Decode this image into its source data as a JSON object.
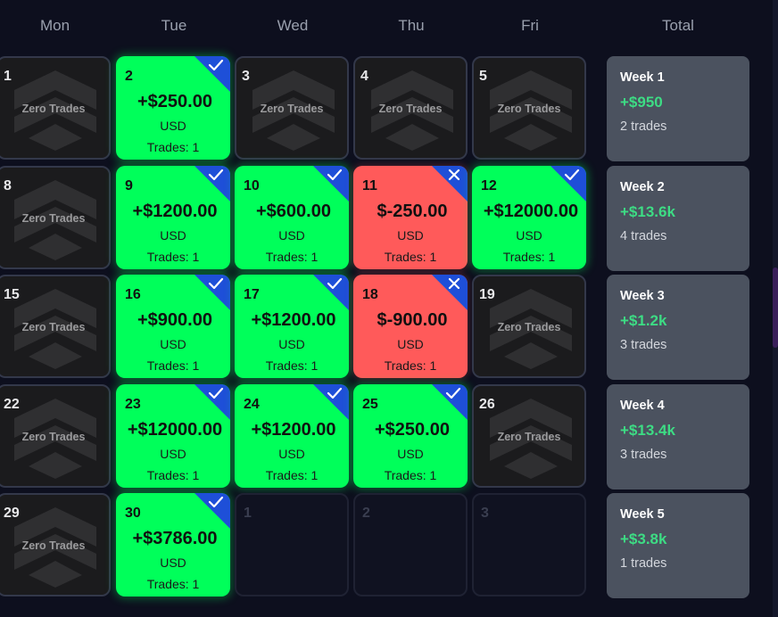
{
  "headers": [
    "Mon",
    "Tue",
    "Wed",
    "Thu",
    "Fri",
    "Total"
  ],
  "zero_label": "Zero Trades",
  "currency": "USD",
  "icons": {
    "zero": "chevrons-up-logo-icon",
    "win": "checkmark-icon",
    "loss": "x-icon"
  },
  "colors": {
    "win": "#00ff5a",
    "loss": "#ff5a5a",
    "corner": "#1e4fd8",
    "week_bg": "#4b525f",
    "week_total": "#3ddc84"
  },
  "rows": [
    [
      {
        "day": "1",
        "type": "zero"
      },
      {
        "day": "2",
        "type": "win",
        "amount": "+$250.00",
        "trades": "Trades: 1"
      },
      {
        "day": "3",
        "type": "zero"
      },
      {
        "day": "4",
        "type": "zero"
      },
      {
        "day": "5",
        "type": "zero"
      }
    ],
    [
      {
        "day": "8",
        "type": "zero"
      },
      {
        "day": "9",
        "type": "win",
        "amount": "+$1200.00",
        "trades": "Trades: 1"
      },
      {
        "day": "10",
        "type": "win",
        "amount": "+$600.00",
        "trades": "Trades: 1"
      },
      {
        "day": "11",
        "type": "loss",
        "amount": "$-250.00",
        "trades": "Trades: 1"
      },
      {
        "day": "12",
        "type": "win",
        "amount": "+$12000.00",
        "trades": "Trades: 1"
      }
    ],
    [
      {
        "day": "15",
        "type": "zero"
      },
      {
        "day": "16",
        "type": "win",
        "amount": "+$900.00",
        "trades": "Trades: 1"
      },
      {
        "day": "17",
        "type": "win",
        "amount": "+$1200.00",
        "trades": "Trades: 1"
      },
      {
        "day": "18",
        "type": "loss",
        "amount": "$-900.00",
        "trades": "Trades: 1"
      },
      {
        "day": "19",
        "type": "zero"
      }
    ],
    [
      {
        "day": "22",
        "type": "zero"
      },
      {
        "day": "23",
        "type": "win",
        "amount": "+$12000.00",
        "trades": "Trades: 1"
      },
      {
        "day": "24",
        "type": "win",
        "amount": "+$1200.00",
        "trades": "Trades: 1"
      },
      {
        "day": "25",
        "type": "win",
        "amount": "+$250.00",
        "trades": "Trades: 1"
      },
      {
        "day": "26",
        "type": "zero"
      }
    ],
    [
      {
        "day": "29",
        "type": "zero"
      },
      {
        "day": "30",
        "type": "win",
        "amount": "+$3786.00",
        "trades": "Trades: 1"
      },
      {
        "day": "1",
        "type": "empty"
      },
      {
        "day": "2",
        "type": "empty"
      },
      {
        "day": "3",
        "type": "empty"
      }
    ]
  ],
  "weeks": [
    {
      "title": "Week 1",
      "total": "+$950",
      "trades": "2 trades"
    },
    {
      "title": "Week 2",
      "total": "+$13.6k",
      "trades": "4 trades"
    },
    {
      "title": "Week 3",
      "total": "+$1.2k",
      "trades": "3 trades"
    },
    {
      "title": "Week 4",
      "total": "+$13.4k",
      "trades": "3 trades"
    },
    {
      "title": "Week 5",
      "total": "+$3.8k",
      "trades": "1 trades"
    }
  ]
}
